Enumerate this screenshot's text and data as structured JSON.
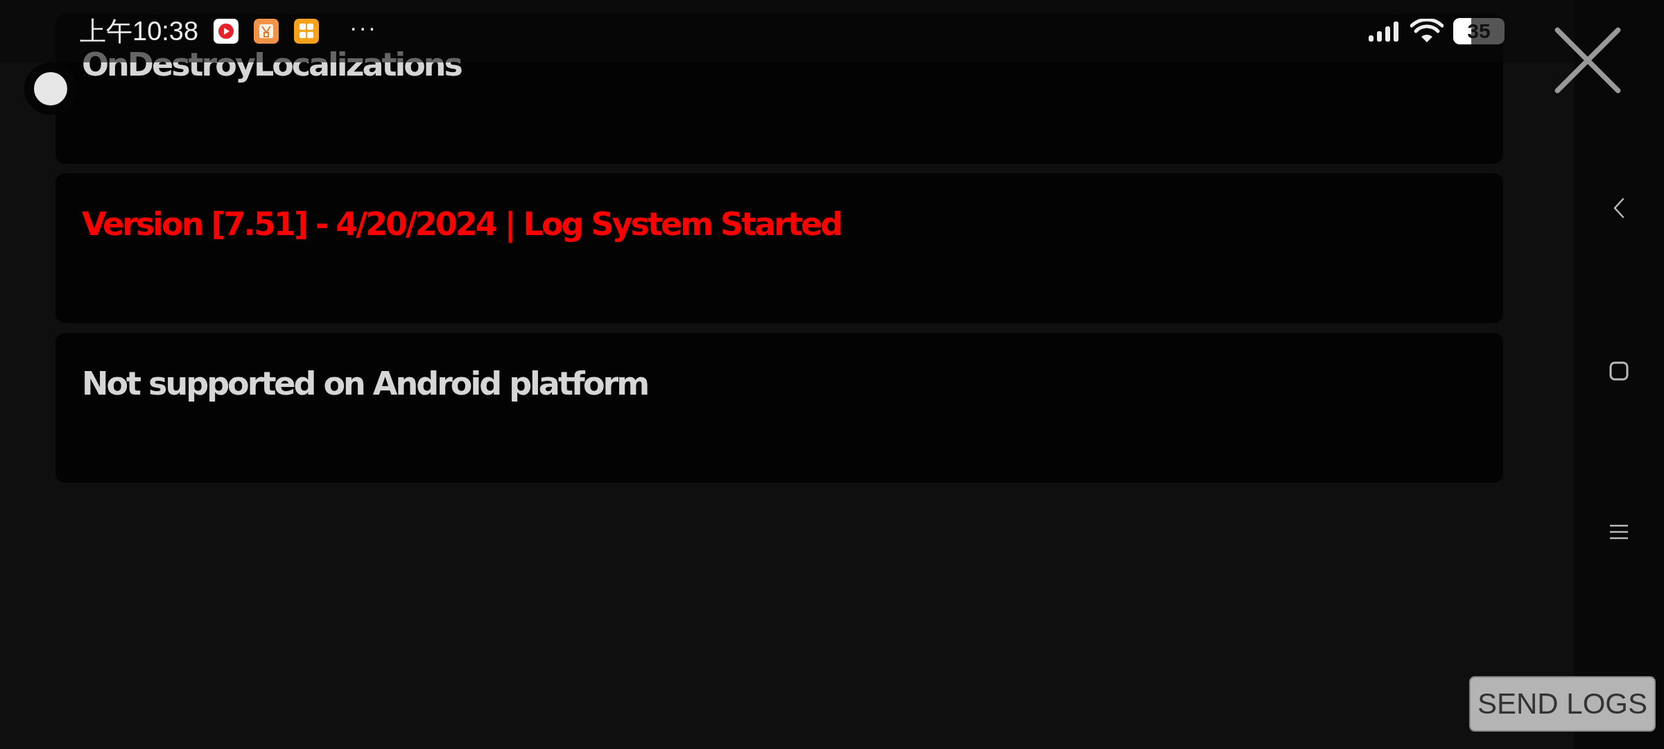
{
  "status_bar": {
    "time": "上午10:38",
    "more": "···",
    "battery": "35"
  },
  "log_entries": [
    {
      "text": "OnDestroyLocalizations",
      "color": "#d6d6d6"
    },
    {
      "text": "Version [7.51] - 4/20/2024 | Log System Started",
      "color": "#ff0000"
    },
    {
      "text": "Not supported on Android platform",
      "color": "#d6d6d6"
    }
  ],
  "send_button": {
    "label": "SEND LOGS"
  }
}
